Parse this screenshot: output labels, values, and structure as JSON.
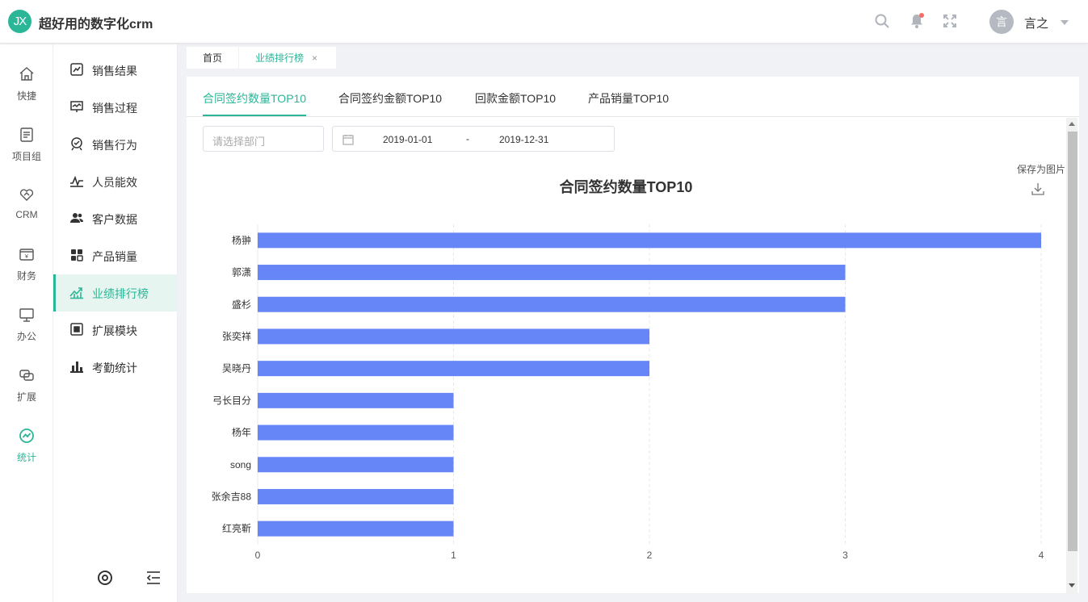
{
  "app": {
    "logo_text": "JX",
    "title": "超好用的数字化crm"
  },
  "header": {
    "user_avatar_text": "言",
    "user_name": "言之"
  },
  "rail": [
    {
      "label": "快捷",
      "icon": "home-icon"
    },
    {
      "label": "项目组",
      "icon": "document-icon"
    },
    {
      "label": "CRM",
      "icon": "handshake-icon"
    },
    {
      "label": "财务",
      "icon": "finance-icon"
    },
    {
      "label": "办公",
      "icon": "monitor-icon"
    },
    {
      "label": "扩展",
      "icon": "extension-icon"
    },
    {
      "label": "统计",
      "icon": "statistics-icon",
      "active": true
    }
  ],
  "submenu": [
    {
      "label": "销售结果",
      "icon": "sales-result-icon"
    },
    {
      "label": "销售过程",
      "icon": "sales-process-icon"
    },
    {
      "label": "销售行为",
      "icon": "sales-behavior-icon"
    },
    {
      "label": "人员能效",
      "icon": "efficiency-icon"
    },
    {
      "label": "客户数据",
      "icon": "customer-icon"
    },
    {
      "label": "产品销量",
      "icon": "product-icon"
    },
    {
      "label": "业绩排行榜",
      "icon": "ranking-icon",
      "active": true
    },
    {
      "label": "扩展模块",
      "icon": "module-icon"
    },
    {
      "label": "考勤统计",
      "icon": "attendance-icon"
    }
  ],
  "page_tabs": [
    {
      "label": "首页"
    },
    {
      "label": "业绩排行榜",
      "active": true,
      "close": "×"
    }
  ],
  "content_tabs": [
    {
      "label": "合同签约数量TOP10",
      "active": true
    },
    {
      "label": "合同签约金额TOP10"
    },
    {
      "label": "回款金额TOP10"
    },
    {
      "label": "产品销量TOP10"
    }
  ],
  "filters": {
    "department_placeholder": "请选择部门",
    "start_date": "2019-01-01",
    "separator": "-",
    "end_date": "2019-12-31"
  },
  "toolbox": {
    "save_label": "保存为图片"
  },
  "colors": {
    "accent": "#2ab697",
    "bar": "#6686f7"
  },
  "chart_data": {
    "type": "bar",
    "orientation": "horizontal",
    "title": "合同签约数量TOP10",
    "categories": [
      "杨翀",
      "郭潇",
      "盛杉",
      "张奕祥",
      "吴晓丹",
      "弓长目分",
      "杨年",
      "song",
      "张余吉88",
      "红亮靳"
    ],
    "values": [
      4,
      3,
      3,
      2,
      2,
      1,
      1,
      1,
      1,
      1
    ],
    "xlim": [
      0,
      4
    ],
    "xticks": [
      0,
      1,
      2,
      3,
      4
    ],
    "grid": true,
    "legend": "none"
  }
}
